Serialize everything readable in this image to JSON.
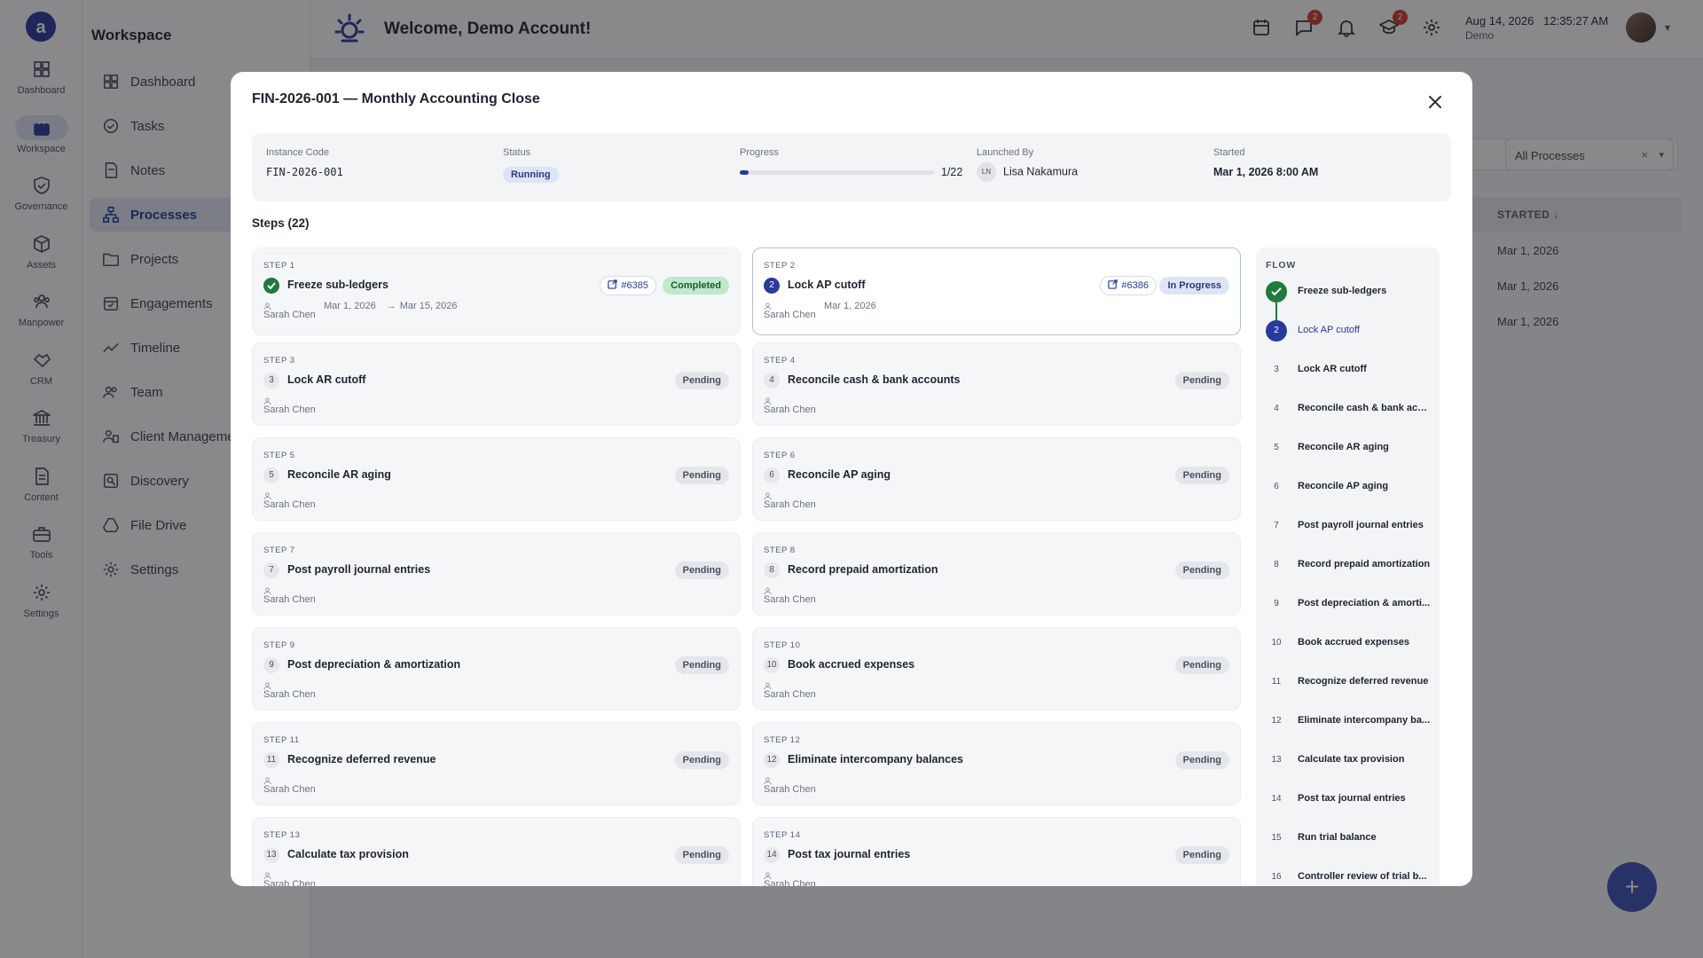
{
  "rail": {
    "items": [
      {
        "label": "Dashboard"
      },
      {
        "label": "Workspace"
      },
      {
        "label": "Governance"
      },
      {
        "label": "Assets"
      },
      {
        "label": "Manpower"
      },
      {
        "label": "CRM"
      },
      {
        "label": "Treasury"
      },
      {
        "label": "Content"
      },
      {
        "label": "Tools"
      },
      {
        "label": "Settings"
      }
    ]
  },
  "sidebar": {
    "title": "Workspace",
    "items": [
      {
        "label": "Dashboard"
      },
      {
        "label": "Tasks"
      },
      {
        "label": "Notes"
      },
      {
        "label": "Processes"
      },
      {
        "label": "Projects"
      },
      {
        "label": "Engagements"
      },
      {
        "label": "Timeline"
      },
      {
        "label": "Team"
      },
      {
        "label": "Client Management"
      },
      {
        "label": "Discovery"
      },
      {
        "label": "File Drive"
      },
      {
        "label": "Settings"
      }
    ]
  },
  "topbar": {
    "title": "Welcome, Demo Account!",
    "messages_badge": "2",
    "learning_badge": "2",
    "datetime": "Aug 14, 2026   12:35:27 AM",
    "user_sub": "Demo"
  },
  "background": {
    "filter_value": "All Processes",
    "column_started": "STARTED",
    "rows": [
      "Mar 1, 2026",
      "Mar 1, 2026",
      "Mar 1, 2026"
    ]
  },
  "modal": {
    "title": "FIN-2026-001 — Monthly Accounting Close",
    "info": {
      "instance_code_label": "Instance Code",
      "instance_code": "FIN-2026-001",
      "status_label": "Status",
      "status": "Running",
      "progress_label": "Progress",
      "progress_text": "1/22",
      "progress_fraction": 0.045,
      "launched_by_label": "Launched By",
      "launched_by_initials": "LN",
      "launched_by": "Lisa Nakamura",
      "started_label": "Started",
      "started": "Mar 1, 2026 8:00 AM"
    },
    "steps_heading": "Steps (22)",
    "steps": [
      {
        "label": "STEP 1",
        "num": "1",
        "name": "Freeze sub-ledgers",
        "user": "Sarah Chen",
        "date": "Mar 1, 2026",
        "due": "Mar 15, 2026",
        "status": "Completed",
        "state": "done",
        "task": "#6385"
      },
      {
        "label": "STEP 2",
        "num": "2",
        "name": "Lock AP cutoff",
        "user": "Sarah Chen",
        "date": "Mar 1, 2026",
        "due": "",
        "status": "In Progress",
        "state": "current",
        "task": "#6386"
      },
      {
        "label": "STEP 3",
        "num": "3",
        "name": "Lock AR cutoff",
        "user": "Sarah Chen",
        "status": "Pending",
        "state": "pending"
      },
      {
        "label": "STEP 4",
        "num": "4",
        "name": "Reconcile cash & bank accounts",
        "user": "Sarah Chen",
        "status": "Pending",
        "state": "pending"
      },
      {
        "label": "STEP 5",
        "num": "5",
        "name": "Reconcile AR aging",
        "user": "Sarah Chen",
        "status": "Pending",
        "state": "pending"
      },
      {
        "label": "STEP 6",
        "num": "6",
        "name": "Reconcile AP aging",
        "user": "Sarah Chen",
        "status": "Pending",
        "state": "pending"
      },
      {
        "label": "STEP 7",
        "num": "7",
        "name": "Post payroll journal entries",
        "user": "Sarah Chen",
        "status": "Pending",
        "state": "pending"
      },
      {
        "label": "STEP 8",
        "num": "8",
        "name": "Record prepaid amortization",
        "user": "Sarah Chen",
        "status": "Pending",
        "state": "pending"
      },
      {
        "label": "STEP 9",
        "num": "9",
        "name": "Post depreciation & amortization",
        "user": "Sarah Chen",
        "status": "Pending",
        "state": "pending"
      },
      {
        "label": "STEP 10",
        "num": "10",
        "name": "Book accrued expenses",
        "user": "Sarah Chen",
        "status": "Pending",
        "state": "pending"
      },
      {
        "label": "STEP 11",
        "num": "11",
        "name": "Recognize deferred revenue",
        "user": "Sarah Chen",
        "status": "Pending",
        "state": "pending"
      },
      {
        "label": "STEP 12",
        "num": "12",
        "name": "Eliminate intercompany balances",
        "user": "Sarah Chen",
        "status": "Pending",
        "state": "pending"
      },
      {
        "label": "STEP 13",
        "num": "13",
        "name": "Calculate tax provision",
        "user": "Sarah Chen",
        "status": "Pending",
        "state": "pending"
      },
      {
        "label": "STEP 14",
        "num": "14",
        "name": "Post tax journal entries",
        "user": "Sarah Chen",
        "status": "Pending",
        "state": "pending"
      }
    ],
    "flow": {
      "title": "FLOW",
      "items": [
        {
          "num": "1",
          "name": "Freeze sub-ledgers",
          "state": "done"
        },
        {
          "num": "2",
          "name": "Lock AP cutoff",
          "state": "current"
        },
        {
          "num": "3",
          "name": "Lock AR cutoff",
          "state": "pending"
        },
        {
          "num": "4",
          "name": "Reconcile cash & bank acc...",
          "state": "pending"
        },
        {
          "num": "5",
          "name": "Reconcile AR aging",
          "state": "pending"
        },
        {
          "num": "6",
          "name": "Reconcile AP aging",
          "state": "pending"
        },
        {
          "num": "7",
          "name": "Post payroll journal entries",
          "state": "pending"
        },
        {
          "num": "8",
          "name": "Record prepaid amortization",
          "state": "pending"
        },
        {
          "num": "9",
          "name": "Post depreciation & amorti...",
          "state": "pending"
        },
        {
          "num": "10",
          "name": "Book accrued expenses",
          "state": "pending"
        },
        {
          "num": "11",
          "name": "Recognize deferred revenue",
          "state": "pending"
        },
        {
          "num": "12",
          "name": "Eliminate intercompany ba...",
          "state": "pending"
        },
        {
          "num": "13",
          "name": "Calculate tax provision",
          "state": "pending"
        },
        {
          "num": "14",
          "name": "Post tax journal entries",
          "state": "pending"
        },
        {
          "num": "15",
          "name": "Run trial balance",
          "state": "pending"
        },
        {
          "num": "16",
          "name": "Controller review of trial b...",
          "state": "pending"
        }
      ]
    }
  },
  "colors": {
    "accent": "#2a3a9c",
    "success": "#1f7a3c",
    "overlay": "rgba(20,20,24,0.5)"
  }
}
